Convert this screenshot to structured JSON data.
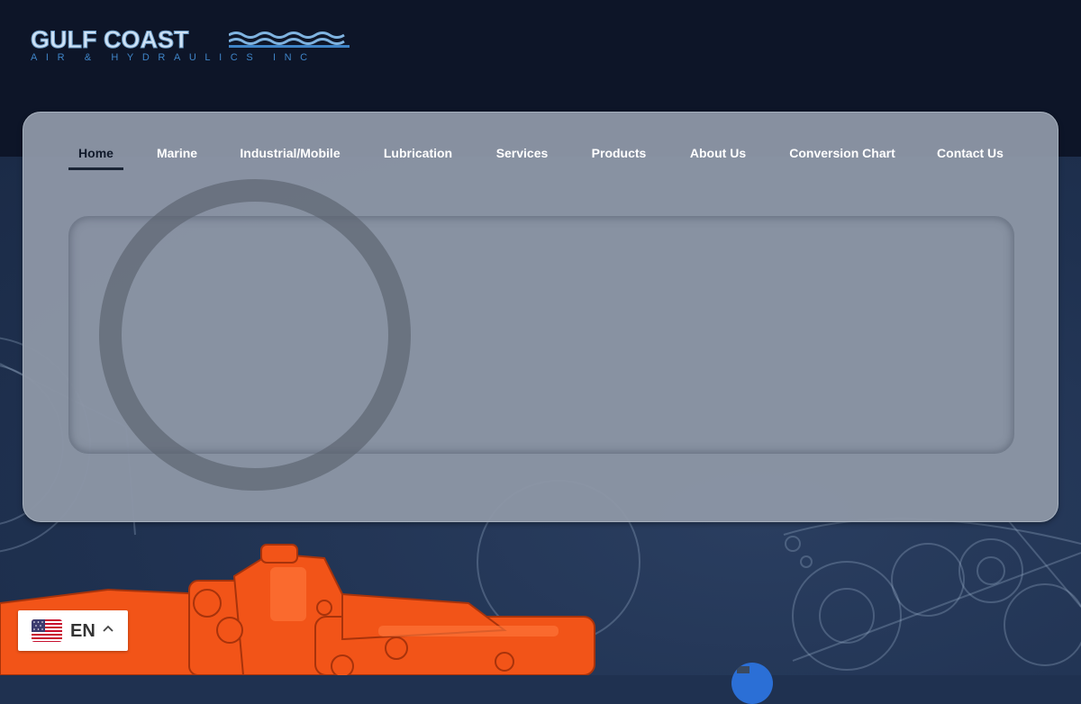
{
  "logo": {
    "main": "GULF COAST",
    "sub": "AIR & HYDRAULICS INC"
  },
  "nav": {
    "items": [
      {
        "label": "Home",
        "active": true
      },
      {
        "label": "Marine",
        "active": false
      },
      {
        "label": "Industrial/Mobile",
        "active": false
      },
      {
        "label": "Lubrication",
        "active": false
      },
      {
        "label": "Services",
        "active": false
      },
      {
        "label": "Products",
        "active": false
      },
      {
        "label": "About Us",
        "active": false
      },
      {
        "label": "Conversion Chart",
        "active": false
      },
      {
        "label": "Contact Us",
        "active": false
      }
    ]
  },
  "language": {
    "code": "EN",
    "flag": "us-flag-icon"
  },
  "colors": {
    "header_bg": "#0d1528",
    "hero_bg": "#1f3150",
    "panel_bg": "#8c96a5",
    "pump_orange": "#f25418",
    "logo_accent": "#3f84c7"
  }
}
